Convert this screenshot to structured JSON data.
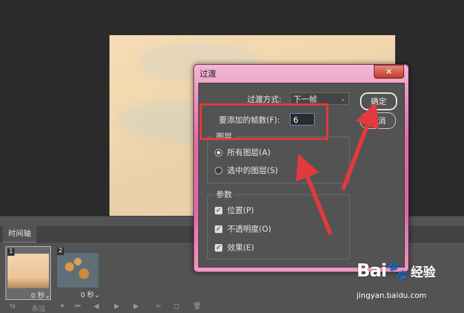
{
  "dialog": {
    "title": "过渡",
    "close": "✕",
    "transition_label": "过渡方式:",
    "transition_value": "下一帧",
    "frames_label": "要添加的帧数(F):",
    "frames_value": "6",
    "layers_group": "图层",
    "layers_options": [
      "所有图层(A)",
      "选中的图层(S)"
    ],
    "params_group": "参数",
    "params": [
      "位置(P)",
      "不透明度(O)",
      "效果(E)"
    ],
    "ok": "确定",
    "cancel": "取消"
  },
  "timeline": {
    "tab": "时间轴",
    "frames": [
      {
        "num": "1",
        "duration": "0 秒"
      },
      {
        "num": "2",
        "duration": "0 秒"
      }
    ],
    "loop": "永远"
  },
  "watermark": {
    "brand": "Bai",
    "brand_cn": "经验",
    "url": "jingyan.baidu.com"
  },
  "colors": {
    "dialog_frame": "#e06fa8",
    "highlight": "#e4393c",
    "panel": "#535353"
  }
}
